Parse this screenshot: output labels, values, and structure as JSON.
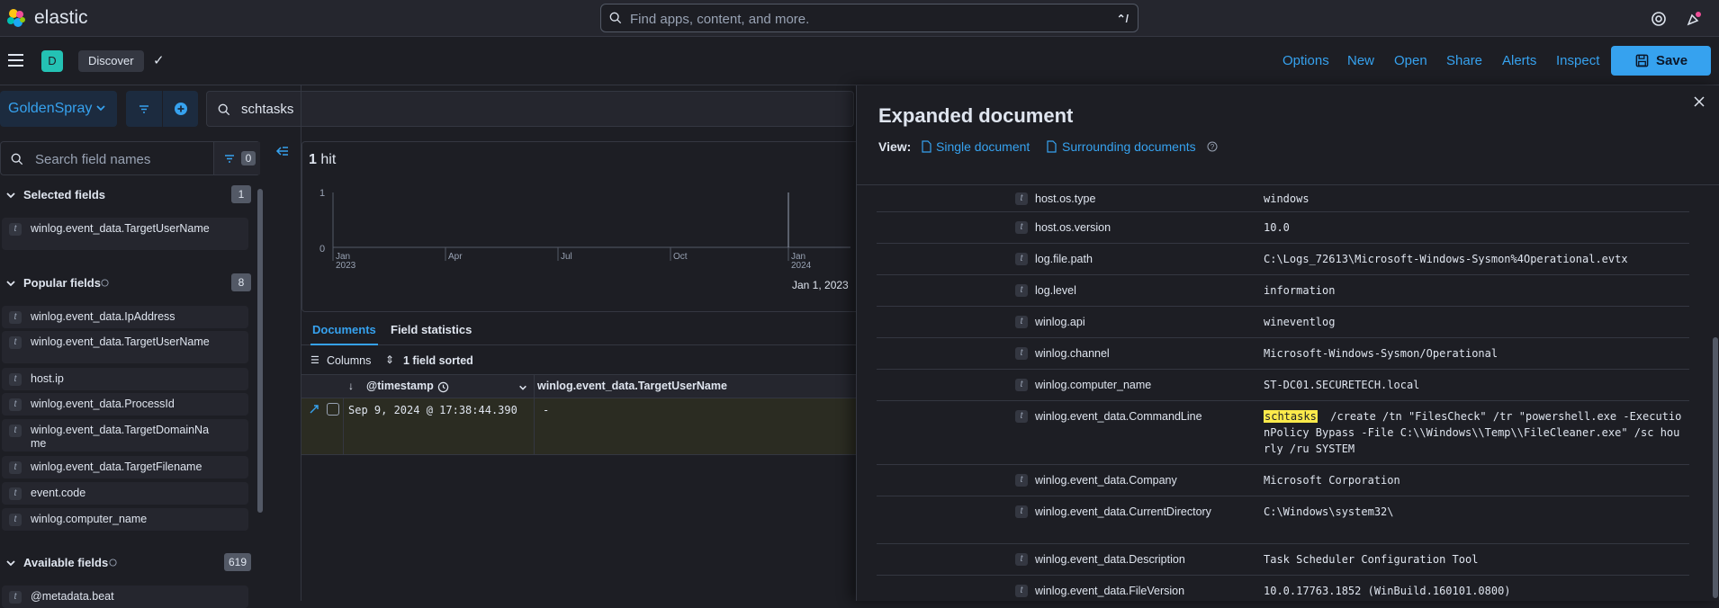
{
  "app": {
    "logo_text": "elastic",
    "global_search_placeholder": "Find apps, content, and more.",
    "global_search_shortcut": "⌃/",
    "space_initial": "D",
    "breadcrumb": "Discover"
  },
  "top_menu": {
    "options": "Options",
    "new": "New",
    "open": "Open",
    "share": "Share",
    "alerts": "Alerts",
    "inspect": "Inspect",
    "save": "Save"
  },
  "query": {
    "data_view": "GoldenSpray",
    "value": "schtasks"
  },
  "sidebar": {
    "search_placeholder": "Search field names",
    "filter_count": "0",
    "selected": {
      "title": "Selected fields",
      "count": "1",
      "fields": [
        "winlog.event_data.TargetUserName"
      ]
    },
    "popular": {
      "title": "Popular fields",
      "count": "8",
      "fields": [
        "winlog.event_data.IpAddress",
        "winlog.event_data.TargetUserName",
        "host.ip",
        "winlog.event_data.ProcessId",
        "winlog.event_data.TargetDomainName",
        "winlog.event_data.TargetFilename",
        "event.code",
        "winlog.computer_name"
      ]
    },
    "available": {
      "title": "Available fields",
      "count": "619",
      "fields": [
        "@metadata.beat"
      ]
    }
  },
  "histogram": {
    "hit_count": "1",
    "hit_label": "hit",
    "y_ticks": [
      "1",
      "0"
    ],
    "x_ticks": [
      {
        "label": "Jan",
        "year": "2023"
      },
      {
        "label": "Apr",
        "year": ""
      },
      {
        "label": "Jul",
        "year": ""
      },
      {
        "label": "Oct",
        "year": ""
      },
      {
        "label": "Jan",
        "year": "2024"
      }
    ],
    "range_label": "Jan 1, 2023 ("
  },
  "tabs": {
    "documents": "Documents",
    "field_statistics": "Field statistics"
  },
  "grid": {
    "columns_label": "Columns",
    "sorted_label": "1 field sorted",
    "col_timestamp": "@timestamp",
    "col_target_user": "winlog.event_data.TargetUserName",
    "row": {
      "timestamp": "Sep 9, 2024 @ 17:38:44.390",
      "target_user": "-"
    }
  },
  "flyout": {
    "title": "Expanded document",
    "view_label": "View:",
    "single_document": "Single document",
    "surrounding_documents": "Surrounding documents",
    "rows": [
      {
        "key": "host.os.type",
        "value": "windows"
      },
      {
        "key": "host.os.version",
        "value": "10.0"
      },
      {
        "key": "log.file.path",
        "value": "C:\\Logs_72613\\Microsoft-Windows-Sysmon%4Operational.evtx"
      },
      {
        "key": "log.level",
        "value": "information"
      },
      {
        "key": "winlog.api",
        "value": "wineventlog"
      },
      {
        "key": "winlog.channel",
        "value": "Microsoft-Windows-Sysmon/Operational"
      },
      {
        "key": "winlog.computer_name",
        "value": "ST-DC01.SECURETECH.local"
      },
      {
        "key": "winlog.event_data.CommandLine",
        "value_highlight": "schtasks",
        "value": "  /create /tn \"FilesCheck\" /tr \"powershell.exe -ExecutionPolicy Bypass -File C:\\\\Windows\\\\Temp\\\\FileCleaner.exe\" /sc hourly /ru SYSTEM"
      },
      {
        "key": "winlog.event_data.Company",
        "value": "Microsoft Corporation"
      },
      {
        "key": "winlog.event_data.CurrentDirectory",
        "value": "C:\\Windows\\system32\\"
      },
      {
        "key": "winlog.event_data.Description",
        "value": "Task Scheduler Configuration Tool"
      },
      {
        "key": "winlog.event_data.FileVersion",
        "value": "10.0.17763.1852 (WinBuild.160101.0800)"
      }
    ]
  },
  "colors": {
    "accent": "#36a2ef",
    "background": "#1d1e24",
    "highlight": "#fcea4b",
    "space_badge": "#24c2b4"
  }
}
